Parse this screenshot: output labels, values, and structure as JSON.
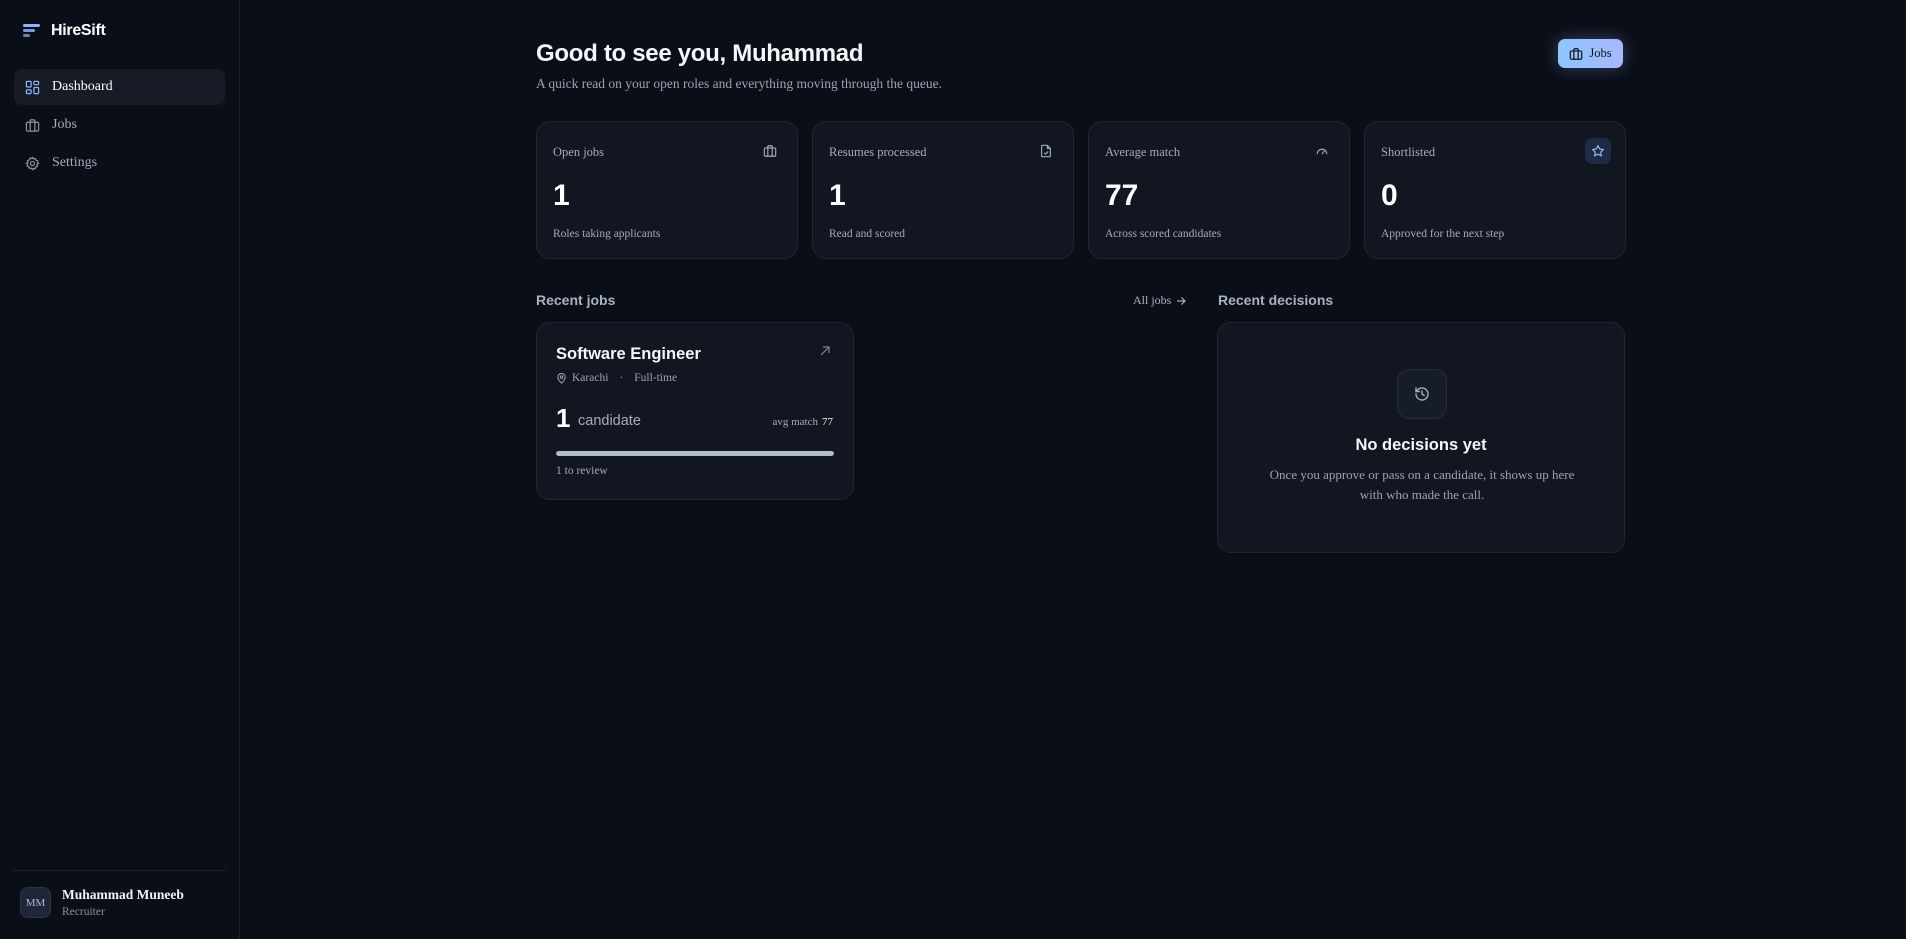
{
  "app": {
    "name": "HireSift"
  },
  "sidebar": {
    "items": [
      {
        "label": "Dashboard",
        "icon": "dashboard-icon",
        "active": true
      },
      {
        "label": "Jobs",
        "icon": "briefcase-icon",
        "active": false
      },
      {
        "label": "Settings",
        "icon": "gear-icon",
        "active": false
      }
    ],
    "user": {
      "initials": "MM",
      "name": "Muhammad Muneeb",
      "role": "Recruiter"
    }
  },
  "header": {
    "greeting": "Good to see you, Muhammad",
    "subtitle": "A quick read on your open roles and everything moving through the queue.",
    "jobs_button": "Jobs"
  },
  "stats": [
    {
      "label": "Open jobs",
      "value": "1",
      "caption": "Roles taking applicants",
      "icon": "briefcase-icon"
    },
    {
      "label": "Resumes processed",
      "value": "1",
      "caption": "Read and scored",
      "icon": "file-check-icon"
    },
    {
      "label": "Average match",
      "value": "77",
      "caption": "Across scored candidates",
      "icon": "gauge-icon"
    },
    {
      "label": "Shortlisted",
      "value": "0",
      "caption": "Approved for the next step",
      "icon": "star-icon"
    }
  ],
  "recent_jobs": {
    "title": "Recent jobs",
    "all_jobs_link": "All jobs",
    "jobs": [
      {
        "title": "Software Engineer",
        "location": "Karachi",
        "type": "Full-time",
        "candidate_count": "1",
        "candidate_label": "candidate",
        "avg_match_label": "avg match",
        "avg_match_value": "77",
        "review_progress": 1.0,
        "review_text": "1 to review"
      }
    ]
  },
  "recent_decisions": {
    "title": "Recent decisions",
    "empty_title": "No decisions yet",
    "empty_text": "Once you approve or pass on a candidate, it shows up here with who made the call."
  },
  "colors": {
    "accent": "#8fb3ff",
    "background": "#0a0e17",
    "card": "#111621"
  }
}
